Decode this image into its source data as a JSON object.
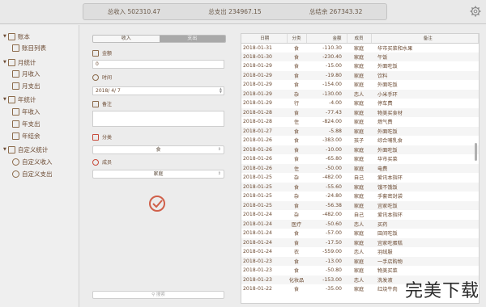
{
  "summary": {
    "income": "总收入 502310.47",
    "expense": "总支出 234967.15",
    "balance": "总结余 267343.32"
  },
  "sidebar": {
    "groups": [
      {
        "label": "账本",
        "items": [
          "账目列表"
        ]
      },
      {
        "label": "月统计",
        "items": [
          "月收入",
          "月支出"
        ]
      },
      {
        "label": "年统计",
        "items": [
          "年收入",
          "年支出",
          "年结余"
        ]
      },
      {
        "label": "自定义统计",
        "items": [
          "自定义收入",
          "自定义支出"
        ]
      }
    ]
  },
  "form": {
    "tab_income": "收入",
    "tab_expense": "支出",
    "amount_label": "金额",
    "amount_value": "0",
    "time_label": "时间",
    "time_value": "2018/ 4/ 7",
    "note_label": "备注",
    "category_label": "分类",
    "category_value": "食",
    "member_label": "成员",
    "member_value": "家庭",
    "search_placeholder": "搜索"
  },
  "table": {
    "headers": [
      "日期",
      "分类",
      "金额",
      "成员",
      "备注"
    ],
    "rows": [
      [
        "2018-01-31",
        "食",
        "-110.30",
        "家庭",
        "华市买菜和水果"
      ],
      [
        "2018-01-30",
        "食",
        "-230.40",
        "家庭",
        "午饭"
      ],
      [
        "2018-01-29",
        "食",
        "-15.00",
        "家庭",
        "外面吃饭"
      ],
      [
        "2018-01-29",
        "食",
        "-19.80",
        "家庭",
        "饮料"
      ],
      [
        "2018-01-29",
        "食",
        "-154.00",
        "家庭",
        "外面吃饭"
      ],
      [
        "2018-01-29",
        "杂",
        "-130.00",
        "恋人",
        "小米手环"
      ],
      [
        "2018-01-29",
        "行",
        "-4.00",
        "家庭",
        "停车费"
      ],
      [
        "2018-01-28",
        "食",
        "-77.43",
        "家庭",
        "物美买食材"
      ],
      [
        "2018-01-28",
        "住",
        "-824.00",
        "家庭",
        "燃气费"
      ],
      [
        "2018-01-27",
        "食",
        "-5.88",
        "家庭",
        "外面吃饭"
      ],
      [
        "2018-01-26",
        "食",
        "-383.00",
        "孩子",
        "综合哺乳食"
      ],
      [
        "2018-01-26",
        "食",
        "-10.00",
        "家庭",
        "外面吃饭"
      ],
      [
        "2018-01-26",
        "食",
        "-65.80",
        "家庭",
        "华市买菜"
      ],
      [
        "2018-01-26",
        "住",
        "-50.00",
        "家庭",
        "电费"
      ],
      [
        "2018-01-25",
        "杂",
        "-482.00",
        "自己",
        "爱讯本指环"
      ],
      [
        "2018-01-25",
        "食",
        "-55.60",
        "家庭",
        "饿不饿饭"
      ],
      [
        "2018-01-25",
        "杂",
        "-24.80",
        "家庭",
        "手套密封袋"
      ],
      [
        "2018-01-25",
        "食",
        "-56.38",
        "家庭",
        "宜家吃饭"
      ],
      [
        "2018-01-24",
        "杂",
        "-482.00",
        "自己",
        "爱讯本指环"
      ],
      [
        "2018-01-24",
        "医疗",
        "-50.60",
        "恋人",
        "买药"
      ],
      [
        "2018-01-24",
        "食",
        "-57.00",
        "家庭",
        "田间吃饭"
      ],
      [
        "2018-01-24",
        "食",
        "-17.50",
        "家庭",
        "宜家吃蛋糕"
      ],
      [
        "2018-01-24",
        "衣",
        "-559.00",
        "恋人",
        "羽绒服"
      ],
      [
        "2018-01-23",
        "食",
        "-13.00",
        "家庭",
        "一手店购物"
      ],
      [
        "2018-01-23",
        "食",
        "-50.80",
        "家庭",
        "物美买菜"
      ],
      [
        "2018-01-23",
        "化妆品",
        "-153.00",
        "恋人",
        "洗发液"
      ],
      [
        "2018-01-22",
        "食",
        "-35.00",
        "家庭",
        "红烧牛肉"
      ]
    ]
  },
  "watermark": "完美下载",
  "icons": [
    "gear-icon",
    "checkmark-icon",
    "search-icon"
  ],
  "colors": {
    "accent": "#d0604a",
    "text": "#6b4a32"
  }
}
